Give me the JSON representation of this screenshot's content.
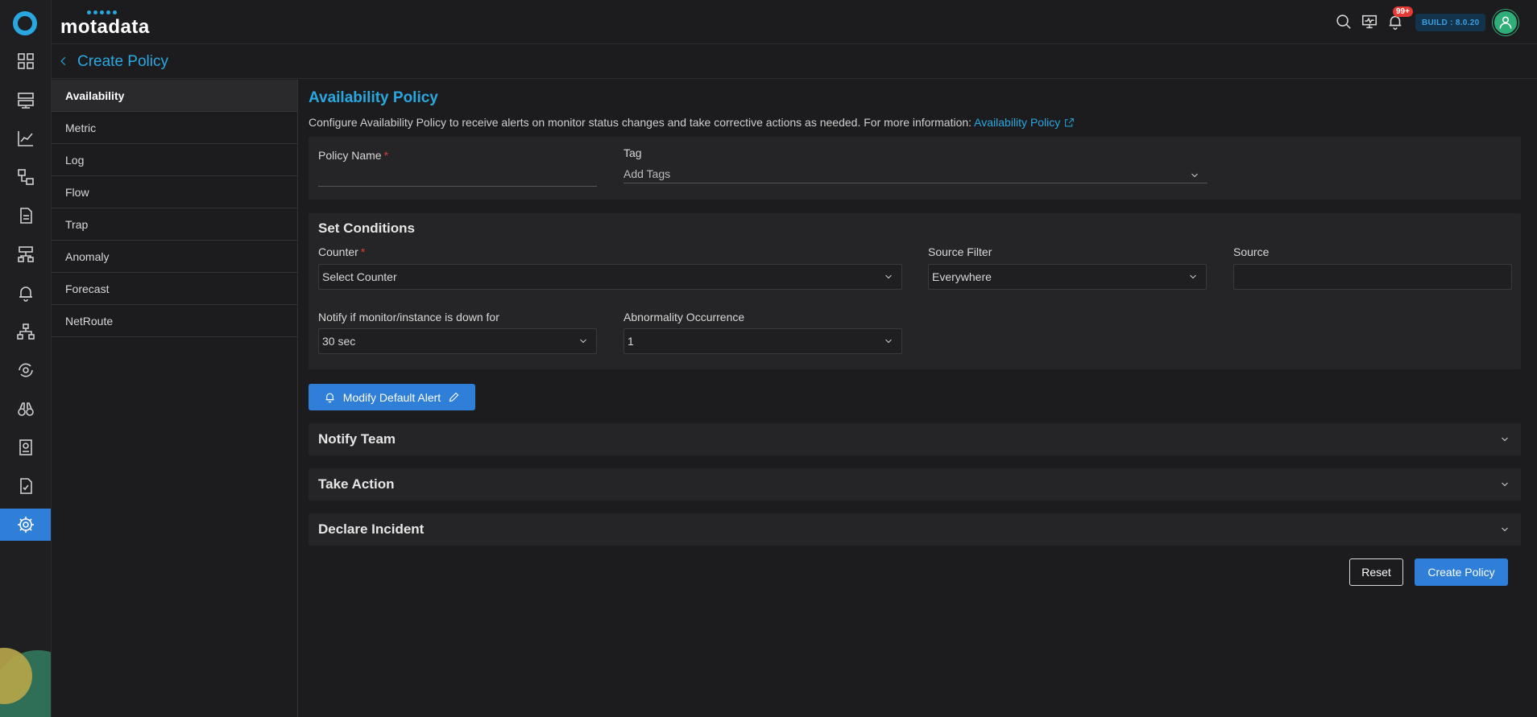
{
  "app": {
    "brand": "motadata",
    "build_label": "BUILD : 8.0.20",
    "notification_badge": "99+"
  },
  "header": {
    "page_title": "Create Policy"
  },
  "rail": {
    "icons": [
      "dashboard-icon",
      "server-icon",
      "metric-explorer-icon",
      "topology-icon",
      "report-icon",
      "network-icon",
      "alert-bell-icon",
      "hierarchy-icon",
      "sync-icon",
      "binoculars-icon",
      "audit-icon",
      "checklist-icon",
      "settings-icon"
    ],
    "active": "settings-icon"
  },
  "sidenav": {
    "items": [
      {
        "label": "Availability",
        "active": true
      },
      {
        "label": "Metric"
      },
      {
        "label": "Log"
      },
      {
        "label": "Flow"
      },
      {
        "label": "Trap"
      },
      {
        "label": "Anomaly"
      },
      {
        "label": "Forecast"
      },
      {
        "label": "NetRoute"
      }
    ]
  },
  "main": {
    "title": "Availability Policy",
    "description": "Configure Availability Policy to receive alerts on monitor status changes and take corrective actions as needed. For more information:",
    "description_link": "Availability Policy",
    "policy_name_label": "Policy Name",
    "policy_name_value": "",
    "tag_label": "Tag",
    "tag_placeholder": "Add Tags",
    "conditions": {
      "title": "Set Conditions",
      "counter_label": "Counter",
      "counter_value": "Select Counter",
      "source_filter_label": "Source Filter",
      "source_filter_value": "Everywhere",
      "source_label": "Source",
      "source_value": "",
      "notify_label": "Notify if monitor/instance is down for",
      "notify_value": "30 sec",
      "abnormality_label": "Abnormality Occurrence",
      "abnormality_value": "1"
    },
    "modify_alert_label": "Modify Default Alert",
    "sections": [
      "Notify Team",
      "Take Action",
      "Declare Incident"
    ],
    "reset_label": "Reset",
    "create_label": "Create Policy"
  },
  "colors": {
    "accent": "#29a8e0",
    "primary_button": "#2f7ed8",
    "required": "#e53935",
    "badge": "#e53935",
    "avatar": "#2fae79"
  }
}
